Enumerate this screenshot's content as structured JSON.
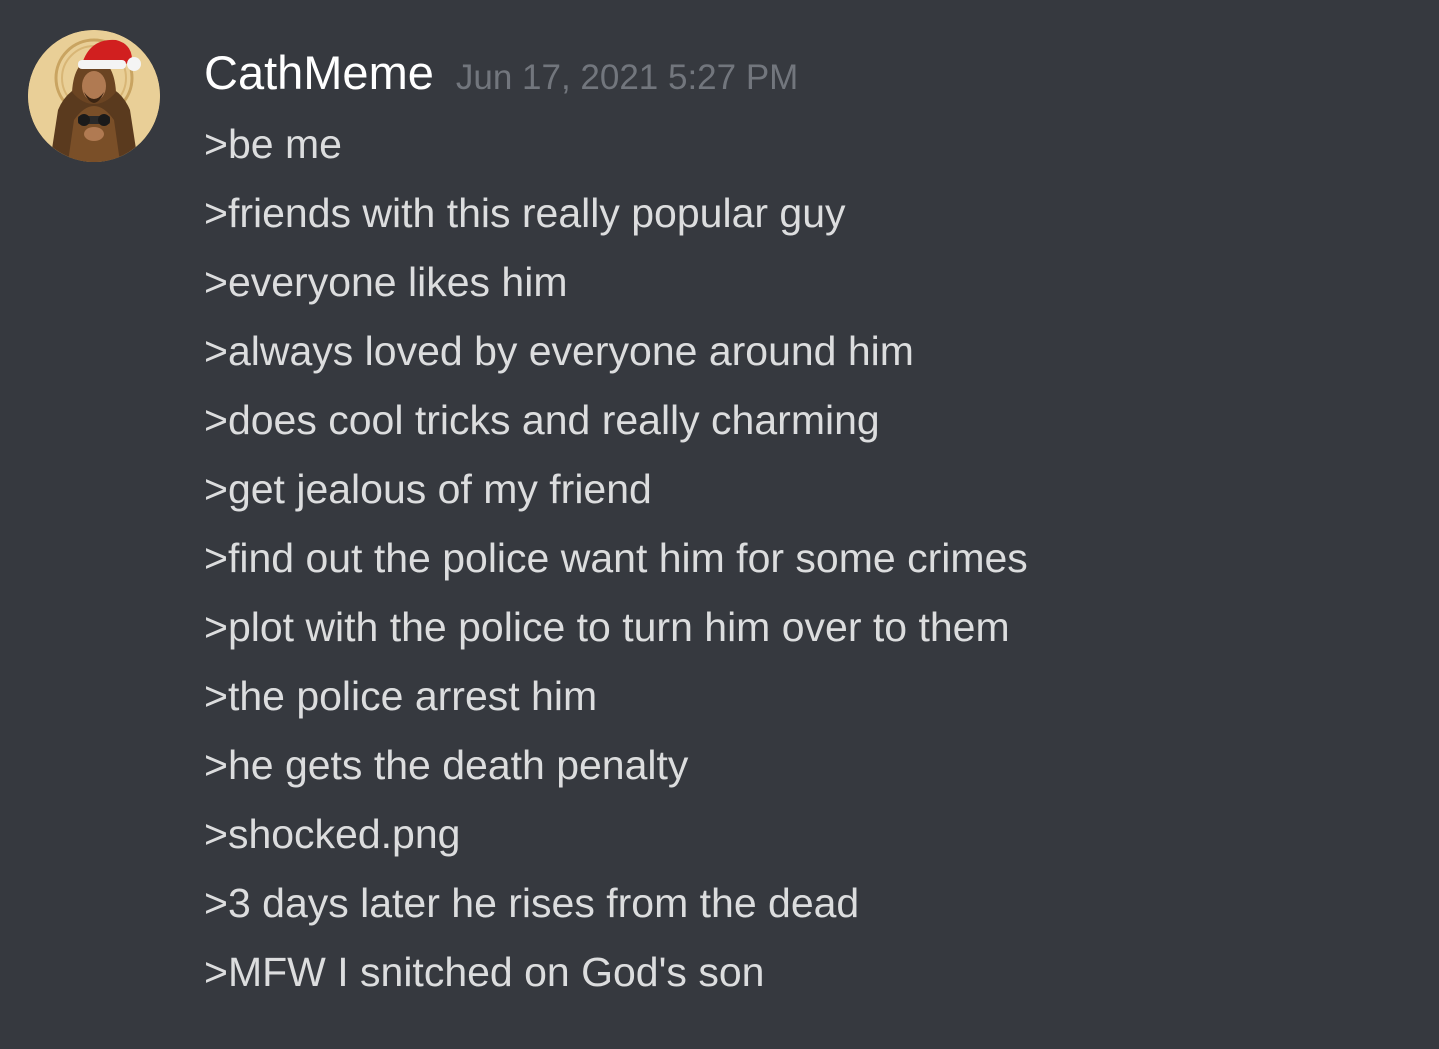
{
  "message": {
    "author": "CathMeme",
    "timestamp": "Jun 17, 2021 5:27 PM",
    "avatar_icon": "user-avatar-hooded-figure-santa-hat",
    "lines": [
      ">be me",
      ">friends with this really popular guy",
      ">everyone likes him",
      ">always loved by everyone around him",
      ">does cool tricks and really charming",
      ">get jealous of my friend",
      ">find out the police want him for some crimes",
      ">plot with the police to turn him over to them",
      ">the police arrest him",
      ">he gets the death penalty",
      ">shocked.png",
      ">3 days later he rises from the dead",
      ">MFW I snitched on God's son"
    ]
  },
  "colors": {
    "background": "#36393f",
    "username": "#ffffff",
    "timestamp": "#72767d",
    "text": "#dcddde"
  }
}
